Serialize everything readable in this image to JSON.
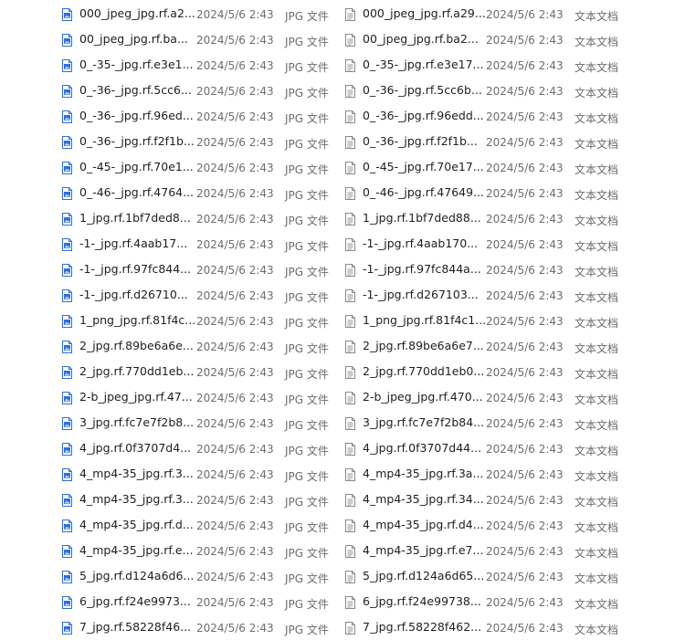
{
  "left_files": [
    {
      "name": "000_jpeg_jpg.rf.a2...",
      "date": "2024/5/6 2:43",
      "type": "JPG 文件"
    },
    {
      "name": "00_jpeg_jpg.rf.ba...",
      "date": "2024/5/6 2:43",
      "type": "JPG 文件"
    },
    {
      "name": "0_-35-_jpg.rf.e3e1...",
      "date": "2024/5/6 2:43",
      "type": "JPG 文件"
    },
    {
      "name": "0_-36-_jpg.rf.5cc6...",
      "date": "2024/5/6 2:43",
      "type": "JPG 文件"
    },
    {
      "name": "0_-36-_jpg.rf.96ed...",
      "date": "2024/5/6 2:43",
      "type": "JPG 文件"
    },
    {
      "name": "0_-36-_jpg.rf.f2f1b...",
      "date": "2024/5/6 2:43",
      "type": "JPG 文件"
    },
    {
      "name": "0_-45-_jpg.rf.70e1...",
      "date": "2024/5/6 2:43",
      "type": "JPG 文件"
    },
    {
      "name": "0_-46-_jpg.rf.4764...",
      "date": "2024/5/6 2:43",
      "type": "JPG 文件"
    },
    {
      "name": "1_jpg.rf.1bf7ded8...",
      "date": "2024/5/6 2:43",
      "type": "JPG 文件"
    },
    {
      "name": "-1-_jpg.rf.4aab17...",
      "date": "2024/5/6 2:43",
      "type": "JPG 文件"
    },
    {
      "name": "-1-_jpg.rf.97fc844...",
      "date": "2024/5/6 2:43",
      "type": "JPG 文件"
    },
    {
      "name": "-1-_jpg.rf.d26710...",
      "date": "2024/5/6 2:43",
      "type": "JPG 文件"
    },
    {
      "name": "1_png_jpg.rf.81f4c...",
      "date": "2024/5/6 2:43",
      "type": "JPG 文件"
    },
    {
      "name": "2_jpg.rf.89be6a6e...",
      "date": "2024/5/6 2:43",
      "type": "JPG 文件"
    },
    {
      "name": "2_jpg.rf.770dd1eb...",
      "date": "2024/5/6 2:43",
      "type": "JPG 文件"
    },
    {
      "name": "2-b_jpeg_jpg.rf.47...",
      "date": "2024/5/6 2:43",
      "type": "JPG 文件"
    },
    {
      "name": "3_jpg.rf.fc7e7f2b8...",
      "date": "2024/5/6 2:43",
      "type": "JPG 文件"
    },
    {
      "name": "4_jpg.rf.0f3707d4...",
      "date": "2024/5/6 2:43",
      "type": "JPG 文件"
    },
    {
      "name": "4_mp4-35_jpg.rf.3...",
      "date": "2024/5/6 2:43",
      "type": "JPG 文件"
    },
    {
      "name": "4_mp4-35_jpg.rf.3...",
      "date": "2024/5/6 2:43",
      "type": "JPG 文件"
    },
    {
      "name": "4_mp4-35_jpg.rf.d...",
      "date": "2024/5/6 2:43",
      "type": "JPG 文件"
    },
    {
      "name": "4_mp4-35_jpg.rf.e...",
      "date": "2024/5/6 2:43",
      "type": "JPG 文件"
    },
    {
      "name": "5_jpg.rf.d124a6d6...",
      "date": "2024/5/6 2:43",
      "type": "JPG 文件"
    },
    {
      "name": "6_jpg.rf.f24e9973...",
      "date": "2024/5/6 2:43",
      "type": "JPG 文件"
    },
    {
      "name": "7_jpg.rf.58228f46...",
      "date": "2024/5/6 2:43",
      "type": "JPG 文件"
    }
  ],
  "right_files": [
    {
      "name": "000_jpeg_jpg.rf.a29...",
      "date": "2024/5/6 2:43",
      "type": "文本文档"
    },
    {
      "name": "00_jpeg_jpg.rf.ba2...",
      "date": "2024/5/6 2:43",
      "type": "文本文档"
    },
    {
      "name": "0_-35-_jpg.rf.e3e17...",
      "date": "2024/5/6 2:43",
      "type": "文本文档"
    },
    {
      "name": "0_-36-_jpg.rf.5cc6b...",
      "date": "2024/5/6 2:43",
      "type": "文本文档"
    },
    {
      "name": "0_-36-_jpg.rf.96edd...",
      "date": "2024/5/6 2:43",
      "type": "文本文档"
    },
    {
      "name": "0_-36-_jpg.rf.f2f1b...",
      "date": "2024/5/6 2:43",
      "type": "文本文档"
    },
    {
      "name": "0_-45-_jpg.rf.70e17...",
      "date": "2024/5/6 2:43",
      "type": "文本文档"
    },
    {
      "name": "0_-46-_jpg.rf.47649...",
      "date": "2024/5/6 2:43",
      "type": "文本文档"
    },
    {
      "name": "1_jpg.rf.1bf7ded88...",
      "date": "2024/5/6 2:43",
      "type": "文本文档"
    },
    {
      "name": "-1-_jpg.rf.4aab170...",
      "date": "2024/5/6 2:43",
      "type": "文本文档"
    },
    {
      "name": "-1-_jpg.rf.97fc844a...",
      "date": "2024/5/6 2:43",
      "type": "文本文档"
    },
    {
      "name": "-1-_jpg.rf.d267103...",
      "date": "2024/5/6 2:43",
      "type": "文本文档"
    },
    {
      "name": "1_png_jpg.rf.81f4c1...",
      "date": "2024/5/6 2:43",
      "type": "文本文档"
    },
    {
      "name": "2_jpg.rf.89be6a6e7...",
      "date": "2024/5/6 2:43",
      "type": "文本文档"
    },
    {
      "name": "2_jpg.rf.770dd1eb0...",
      "date": "2024/5/6 2:43",
      "type": "文本文档"
    },
    {
      "name": "2-b_jpeg_jpg.rf.470...",
      "date": "2024/5/6 2:43",
      "type": "文本文档"
    },
    {
      "name": "3_jpg.rf.fc7e7f2b84...",
      "date": "2024/5/6 2:43",
      "type": "文本文档"
    },
    {
      "name": "4_jpg.rf.0f3707d44...",
      "date": "2024/5/6 2:43",
      "type": "文本文档"
    },
    {
      "name": "4_mp4-35_jpg.rf.3a...",
      "date": "2024/5/6 2:43",
      "type": "文本文档"
    },
    {
      "name": "4_mp4-35_jpg.rf.34...",
      "date": "2024/5/6 2:43",
      "type": "文本文档"
    },
    {
      "name": "4_mp4-35_jpg.rf.d4...",
      "date": "2024/5/6 2:43",
      "type": "文本文档"
    },
    {
      "name": "4_mp4-35_jpg.rf.e7...",
      "date": "2024/5/6 2:43",
      "type": "文本文档"
    },
    {
      "name": "5_jpg.rf.d124a6d65...",
      "date": "2024/5/6 2:43",
      "type": "文本文档"
    },
    {
      "name": "6_jpg.rf.f24e99738...",
      "date": "2024/5/6 2:43",
      "type": "文本文档"
    },
    {
      "name": "7_jpg.rf.58228f462...",
      "date": "2024/5/6 2:43",
      "type": "文本文档"
    }
  ],
  "icons": {
    "left": "jpg-file-icon",
    "right": "text-document-icon"
  },
  "colors": {
    "jpg_icon_blue": "#2f6fd6",
    "text_icon_gray": "#8a8a8a",
    "meta_gray": "#6d6d6d"
  }
}
